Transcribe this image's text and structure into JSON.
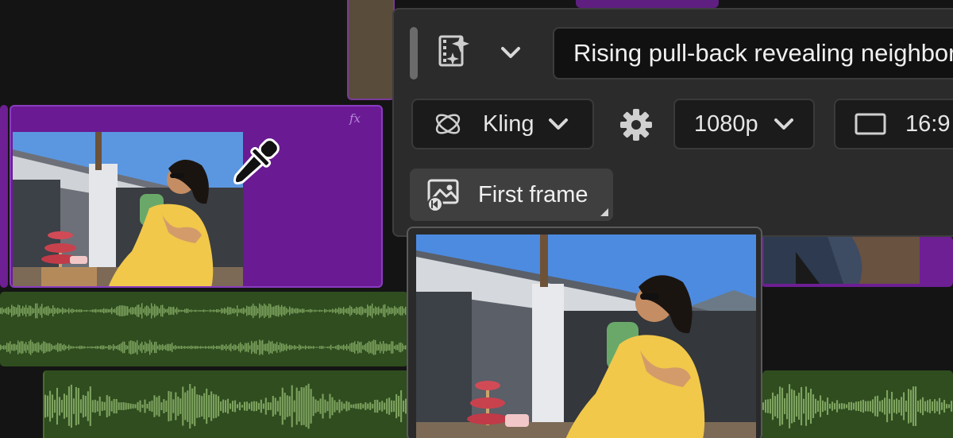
{
  "timeline": {
    "fx_label": "fx"
  },
  "panel": {
    "prompt_value": "Rising pull-back revealing neighborho",
    "model_dropdown": {
      "label": "Kling",
      "icon": "model-logo-icon"
    },
    "resolution_dropdown": {
      "label": "1080p"
    },
    "aspect_dropdown": {
      "label": "16:9",
      "icon": "aspect-rectangle-icon"
    },
    "first_frame_button": {
      "label": "First frame",
      "icon": "first-frame-image-icon"
    }
  },
  "colors": {
    "panel_bg": "#2b2b2b",
    "video_clip": "#6a1a93",
    "audio_clip": "#2f4d1f",
    "waveform": "#7ea35f"
  }
}
